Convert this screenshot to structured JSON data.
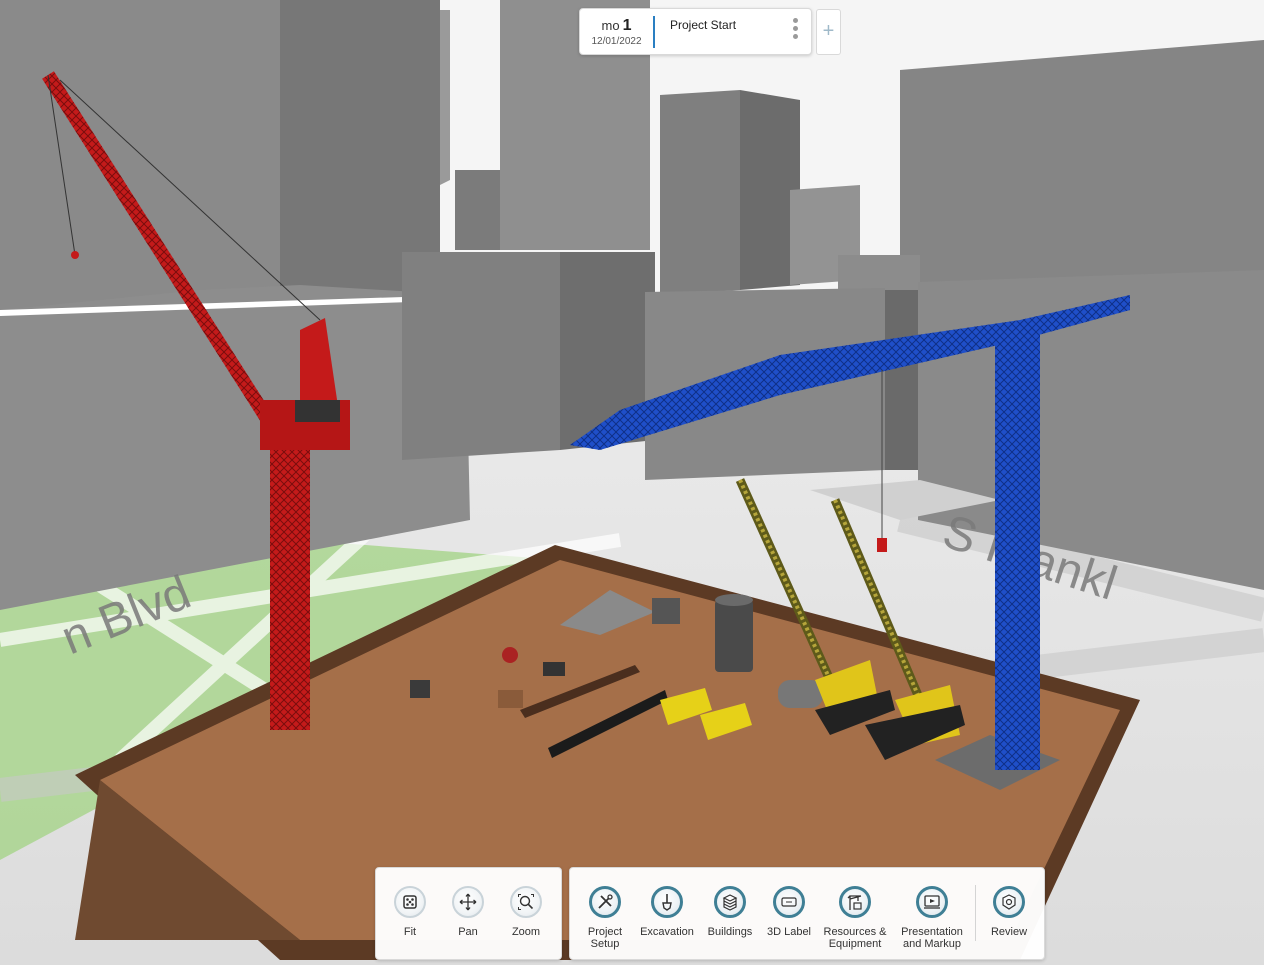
{
  "phase": {
    "unit": "mo",
    "number": "1",
    "date": "12/01/2022",
    "name": "Project Start"
  },
  "view_tools": [
    {
      "label": "Fit",
      "icon": "fit-icon"
    },
    {
      "label": "Pan",
      "icon": "pan-icon"
    },
    {
      "label": "Zoom",
      "icon": "zoom-icon"
    }
  ],
  "main_tools": [
    {
      "label_1": "Project",
      "label_2": "Setup",
      "icon": "project-setup-icon"
    },
    {
      "label_1": "Excavation",
      "label_2": "",
      "icon": "excavation-icon"
    },
    {
      "label_1": "Buildings",
      "label_2": "",
      "icon": "buildings-icon"
    },
    {
      "label_1": "3D Label",
      "label_2": "",
      "icon": "3d-label-icon"
    },
    {
      "label_1": "Resources &",
      "label_2": "Equipment",
      "icon": "resources-equipment-icon"
    },
    {
      "label_1": "Presentation",
      "label_2": "and Markup",
      "icon": "presentation-markup-icon"
    },
    {
      "label_1": "Review",
      "label_2": "",
      "icon": "review-icon"
    }
  ],
  "map_labels": {
    "street_left": "n Blvd",
    "street_right": "S Frankl"
  },
  "colors": {
    "accent": "#3f7f95",
    "crane_red": "#c41a1a",
    "crane_blue": "#1f4fc9",
    "crawler_yellow": "#e0c51a",
    "dirt": "#a56f49",
    "building": "#8e8e8e"
  }
}
